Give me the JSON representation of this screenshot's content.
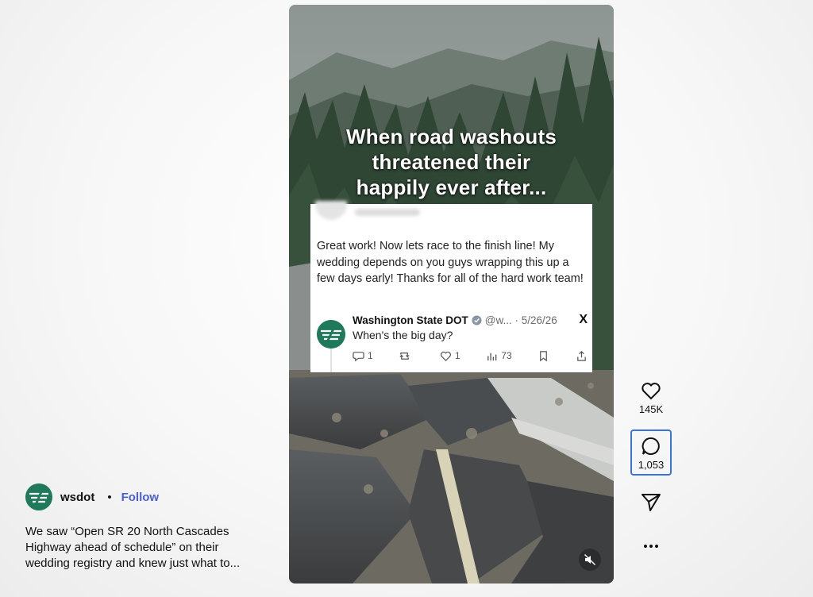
{
  "reel": {
    "caption_lines": [
      "When road washouts",
      "threatened their",
      "happily ever after..."
    ],
    "tweet": {
      "text": "Great work! Now lets race to the finish line! My wedding depends on you guys wrapping this up a few days early! Thanks for all of the hard work team!",
      "reply": {
        "name": "Washington State DOT",
        "handle_date": "@w... · 5/26/26",
        "x_logo": "X",
        "text": "When's the big day?",
        "actions": {
          "replies": "1",
          "retweets": "",
          "likes": "1",
          "views": "73"
        }
      }
    },
    "mute_icon": "muted-speaker-icon"
  },
  "side_actions": {
    "like_count": "145K",
    "comment_count": "1,053",
    "icons": [
      "heart-icon",
      "comment-icon",
      "send-icon",
      "more-icon"
    ]
  },
  "author": {
    "username": "wsdot",
    "separator": "•",
    "follow_label": "Follow",
    "caption": "We saw “Open SR 20 North Cascades Highway ahead of schedule” on their wedding registry and knew just what to..."
  },
  "colors": {
    "accent": "#4a5fd6",
    "brand_green": "#1f7a5b",
    "selection": "#3b74d8"
  }
}
